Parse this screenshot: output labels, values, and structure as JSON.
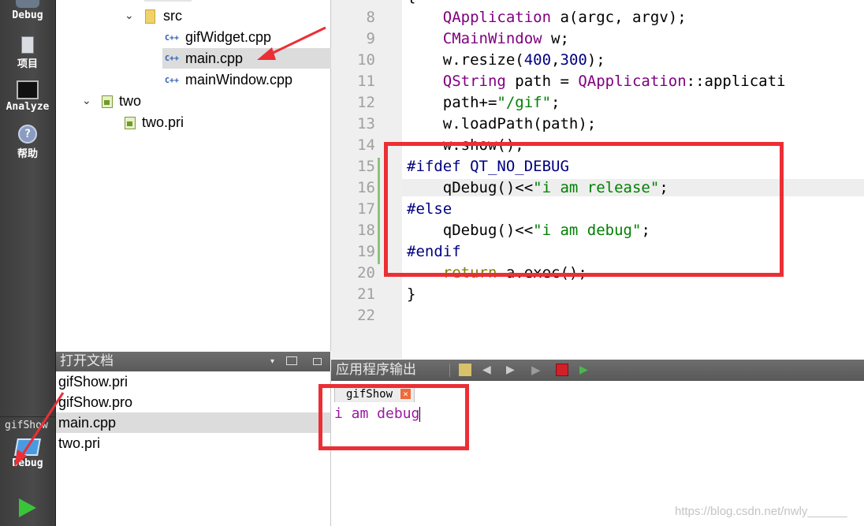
{
  "modebar": {
    "debug_top_label": "Debug",
    "project_label": "项目",
    "analyze_label": "Analyze",
    "help_label": "帮助",
    "kit_label": "gifShow",
    "kit_mode_label": "Debug"
  },
  "tree": {
    "src_label": "src",
    "files": [
      "gifWidget.cpp",
      "main.cpp",
      "mainWindow.cpp"
    ],
    "project_two": "two",
    "two_pri": "two.pri",
    "cpp_icon_text": "C++"
  },
  "open_docs": {
    "title": "打开文档",
    "items": [
      "gifShow.pri",
      "gifShow.pro",
      "main.cpp",
      "two.pri"
    ]
  },
  "editor": {
    "line_numbers": [
      "8",
      "9",
      "10",
      "11",
      "12",
      "13",
      "14",
      "15",
      "16",
      "17",
      "18",
      "19",
      "20",
      "21",
      "22"
    ],
    "lines": {
      "l8_type": "QApplication",
      "l8_rest": " a(argc, argv);",
      "l9_type": "CMainWindow",
      "l9_rest": " w;",
      "l10_a": "w.resize(",
      "l10_n1": "400",
      "l10_c": ",",
      "l10_n2": "300",
      "l10_b": ");",
      "l11_type": "QString",
      "l11_mid": " path = ",
      "l11_cls": "QApplication",
      "l11_rest": "::applicati",
      "l12_a": "path+=",
      "l12_s": "\"/gif\"",
      "l12_b": ";",
      "l13": "w.loadPath(path);",
      "l14": "w.show();",
      "l15_pp": "#ifdef",
      "l15_mac": " QT_NO_DEBUG",
      "l16_a": "qDebug()<<",
      "l16_s": "\"i am release\"",
      "l16_b": ";",
      "l17_pp": "#else",
      "l18_a": "qDebug()<<",
      "l18_s": "\"i am debug\"",
      "l18_b": ";",
      "l19_pp": "#endif",
      "l20_kw": "return",
      "l20_rest": " a.exec();",
      "l21": "}"
    }
  },
  "output": {
    "title": "应用程序输出",
    "tab_label": "gifShow",
    "text": "i am debug"
  },
  "watermark": "https://blog.csdn.net/nwly______",
  "colors": {
    "annotation_red": "#ec2e35",
    "output_text": "#9a1aa0"
  }
}
